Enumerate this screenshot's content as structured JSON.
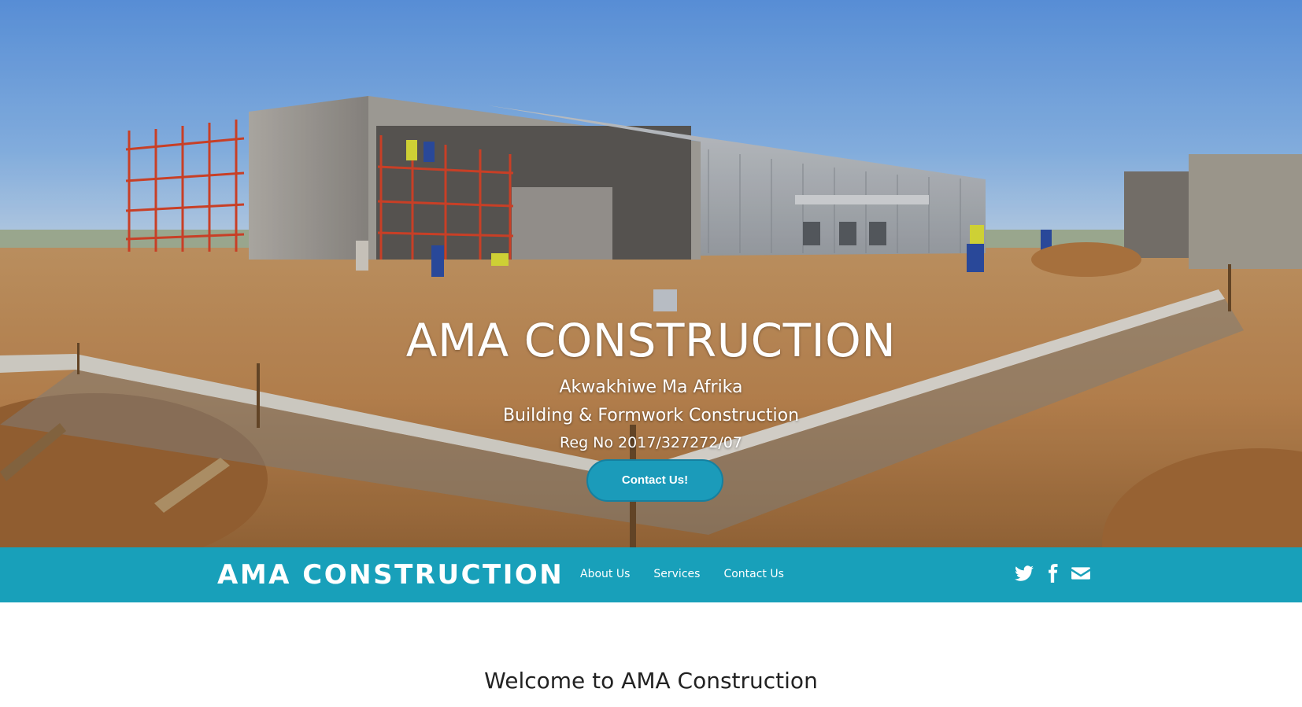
{
  "hero": {
    "title": "AMA CONSTRUCTION",
    "tagline": "Akwakhiwe Ma Afrika",
    "subtitle": "Building & Formwork Construction",
    "reg": "Reg No 2017/327272/07",
    "cta_label": "Contact Us!"
  },
  "navbar": {
    "brand": "AMA CONSTRUCTION",
    "links": [
      "About Us",
      "Services",
      "Contact Us"
    ],
    "social": [
      "twitter-icon",
      "facebook-icon",
      "envelope-icon"
    ]
  },
  "main": {
    "welcome_heading": "Welcome to AMA Construction"
  },
  "colors": {
    "accent": "#18a0ba",
    "button": "#1b9bba",
    "text": "#222222"
  }
}
